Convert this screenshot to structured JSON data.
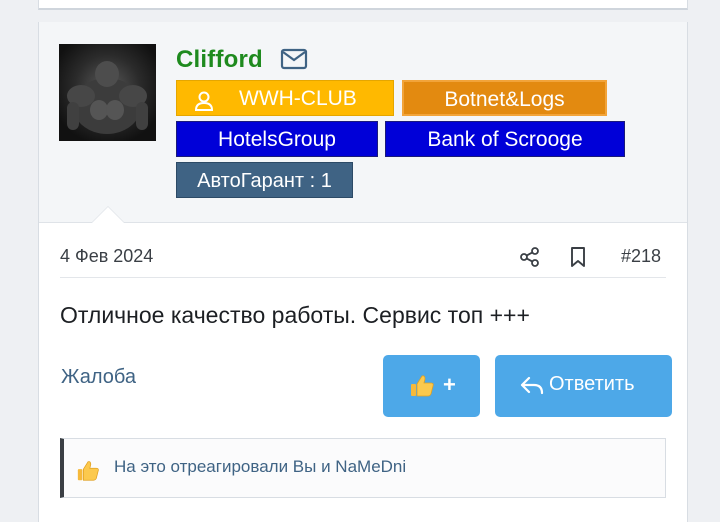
{
  "user": {
    "name": "Clifford",
    "badges": {
      "wwh": "WWH-CLUB",
      "botnet": "Botnet&Logs",
      "hotels": "HotelsGroup",
      "bank": "Bank of Scrooge",
      "avto": "АвтоГарант : 1"
    }
  },
  "post": {
    "date": "4 Фев 2024",
    "number": "#218",
    "message": "Отличное качество работы. Сервис топ +++"
  },
  "actions": {
    "report": "Жалоба",
    "like_plus": "+",
    "reply": "Ответить"
  },
  "reactions": {
    "text": "На это отреагировали Вы и NaMeDni"
  },
  "colors": {
    "username": "#1e8a1e",
    "button": "#4da8e8",
    "link": "#3f6384"
  },
  "icons": [
    "envelope-icon",
    "user-icon",
    "share-icon",
    "bookmark-icon",
    "thumbs-up-icon",
    "reply-icon"
  ]
}
